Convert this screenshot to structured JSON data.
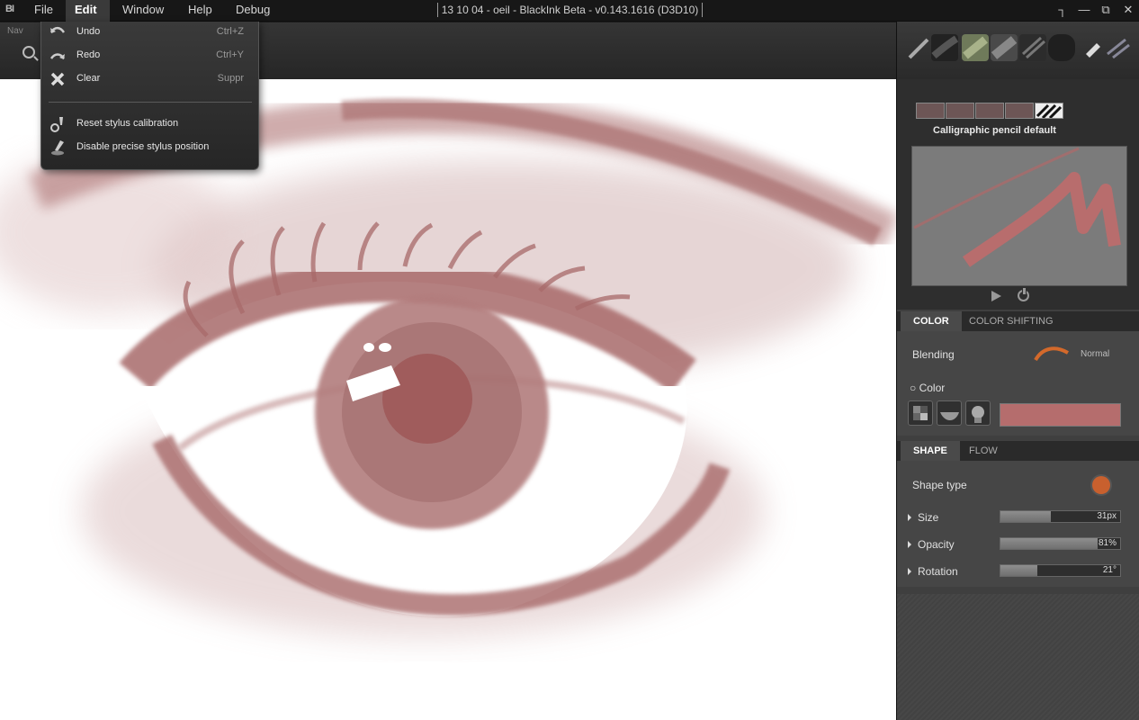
{
  "app": {
    "logo": "BI",
    "title": "13 10 04 - oeil - BlackInk Beta - v0.143.1616 (D3D10)"
  },
  "menubar": {
    "items": [
      "File",
      "Edit",
      "Window",
      "Help",
      "Debug"
    ],
    "active": "Edit"
  },
  "toolbar": {
    "nav_label": "Nav"
  },
  "edit_menu": {
    "items": [
      {
        "label": "Undo",
        "shortcut": "Ctrl+Z",
        "icon": "undo-icon"
      },
      {
        "label": "Redo",
        "shortcut": "Ctrl+Y",
        "icon": "redo-icon"
      },
      {
        "label": "Clear",
        "shortcut": "Suppr",
        "icon": "clear-icon"
      },
      {
        "label": "Reset stylus calibration",
        "shortcut": "",
        "icon": "stylus-reset-icon"
      },
      {
        "label": "Disable precise stylus position",
        "shortcut": "",
        "icon": "stylus-precise-icon"
      }
    ]
  },
  "panel": {
    "preset_name": "Calligraphic pencil default",
    "color_tabs": [
      "COLOR",
      "COLOR SHIFTING"
    ],
    "blending_label": "Blending",
    "blending_value": "Normal",
    "color_label": "Color",
    "color_value": "#b56d6d",
    "shape_tabs": [
      "SHAPE",
      "FLOW"
    ],
    "shape_type_label": "Shape type",
    "params": [
      {
        "label": "Size",
        "value": "31px",
        "fraction": 0.42
      },
      {
        "label": "Opacity",
        "value": "81%",
        "fraction": 0.81
      },
      {
        "label": "Rotation",
        "value": "21°",
        "fraction": 0.31
      }
    ]
  },
  "colors": {
    "ink": "#a86a6a",
    "shape_dot": "#c8602e"
  }
}
